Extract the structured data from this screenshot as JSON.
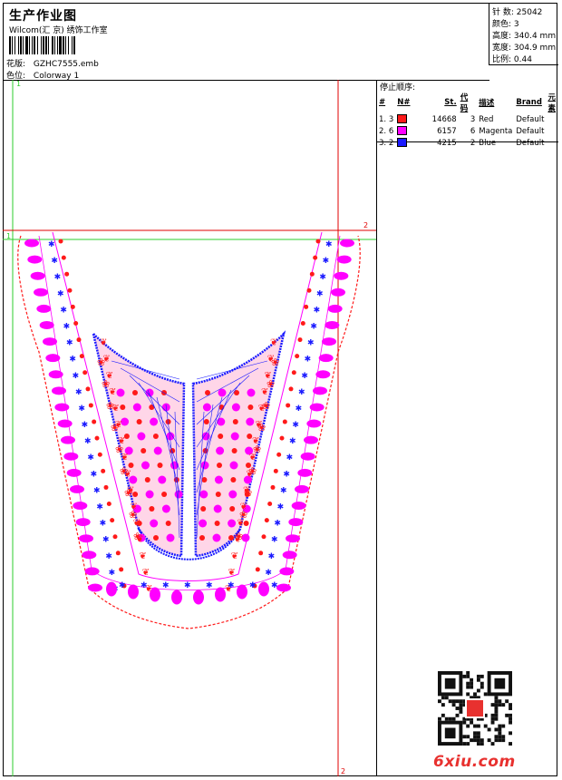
{
  "header": {
    "title": "生产作业图",
    "company": "Wilcom(汇 京) 绣饰工作室",
    "design_label": "花版:",
    "design_value": "GZHC7555.emb",
    "colorway_label": "色位:",
    "colorway_value": "Colorway 1"
  },
  "stats": [
    {
      "label": "针 数:",
      "value": "25042"
    },
    {
      "label": "颜色:",
      "value": "3"
    },
    {
      "label": "高度:",
      "value": "340.4 mm"
    },
    {
      "label": "宽度:",
      "value": "304.9 mm"
    },
    {
      "label": "比例:",
      "value": "0.44"
    }
  ],
  "stop_sequence": {
    "title": "停止顺序:",
    "columns": [
      "#",
      "N#",
      "St.",
      "代码",
      "描述",
      "Brand",
      "元素"
    ],
    "rows": [
      {
        "index": "1.",
        "needle": "3",
        "color": "#ff1a1a",
        "stitches": "14668",
        "code": "3",
        "description": "Red",
        "brand": "Default"
      },
      {
        "index": "2.",
        "needle": "6",
        "color": "#ff00ff",
        "stitches": "6157",
        "code": "6",
        "description": "Magenta",
        "brand": "Default"
      },
      {
        "index": "3.",
        "needle": "2",
        "color": "#1a1aff",
        "stitches": "4215",
        "code": "2",
        "description": "Blue",
        "brand": "Default"
      }
    ]
  },
  "guides": {
    "marker_1": "1",
    "marker_2": "2"
  },
  "colors": {
    "red": "#ff1a1a",
    "magenta": "#ff00ff",
    "blue": "#1a1aff",
    "green_guide": "#2ecc2e",
    "red_guide": "#e00000"
  },
  "watermark": {
    "brand": "6xiu.com",
    "qr_icon": "qr-code-icon"
  }
}
